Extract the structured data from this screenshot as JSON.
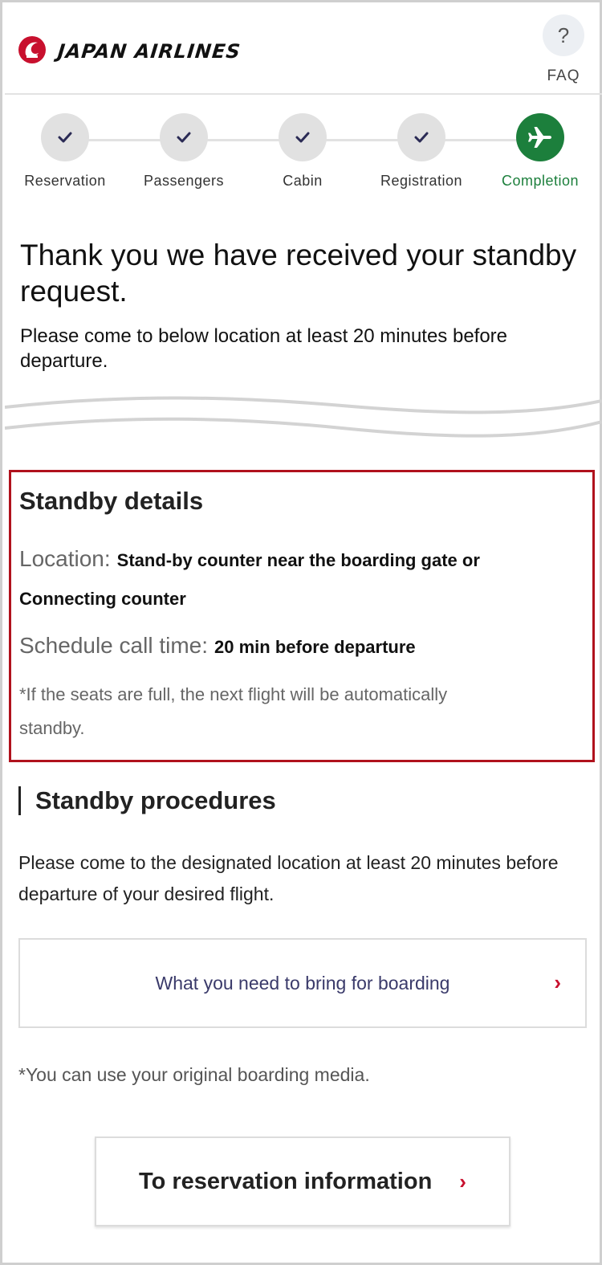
{
  "header": {
    "brand": "JAPAN AIRLINES",
    "faq_icon": "?",
    "faq_label": "FAQ",
    "brand_color": "#c8102e"
  },
  "stepper": {
    "steps": [
      {
        "label": "Reservation",
        "state": "done",
        "icon": "check-icon"
      },
      {
        "label": "Passengers",
        "state": "done",
        "icon": "check-icon"
      },
      {
        "label": "Cabin",
        "state": "done",
        "icon": "check-icon"
      },
      {
        "label": "Registration",
        "state": "done",
        "icon": "check-icon"
      },
      {
        "label": "Completion",
        "state": "active",
        "icon": "airplane-icon"
      }
    ],
    "active_color": "#1c7f3c"
  },
  "thanks": {
    "title": "Thank you we have received your standby request.",
    "subtitle": "Please come to below location at least 20 minutes before departure."
  },
  "details": {
    "title": "Standby details",
    "location_label": "Location:",
    "location_value": "Stand-by counter near the boarding gate or Connecting counter",
    "schedule_label": "Schedule call time:",
    "schedule_value": "20 min before departure",
    "note": "*If the seats are full, the next flight will be automatically standby.",
    "border_color": "#b0121d"
  },
  "procedures": {
    "heading": "Standby procedures",
    "text": "Please come to the designated location at least 20 minutes before departure of your desired flight.",
    "bring_button": "What you need to bring for boarding",
    "media_note": "*You can use your original boarding media.",
    "reservation_button": "To reservation information",
    "chevron": "›"
  }
}
